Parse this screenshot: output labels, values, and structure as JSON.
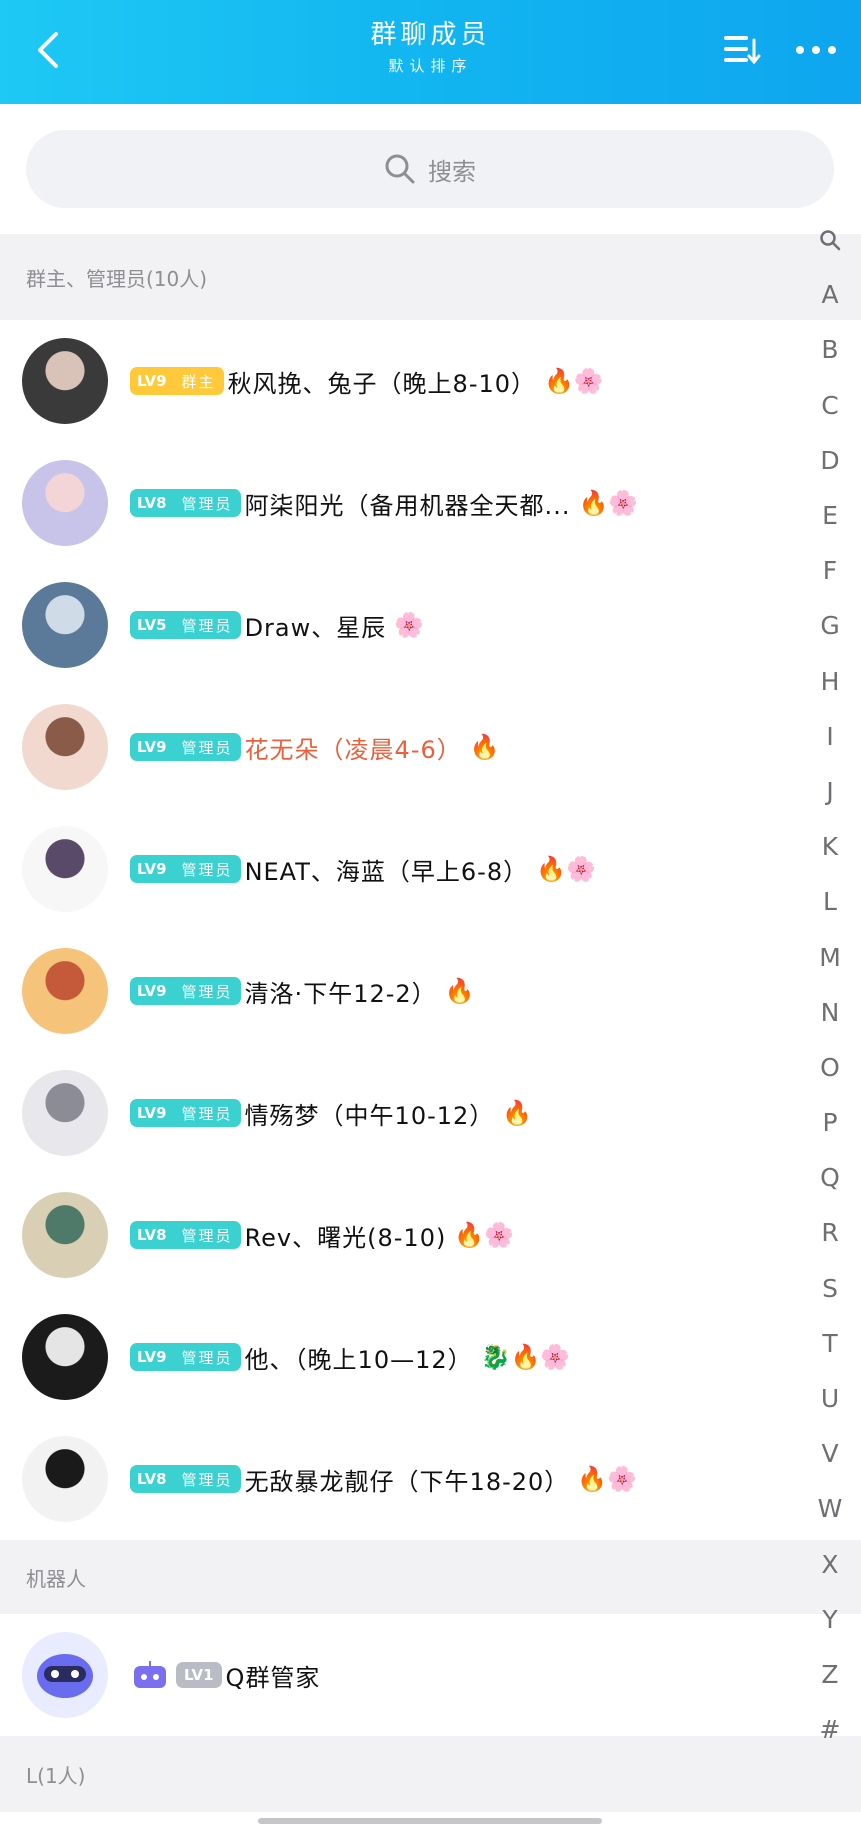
{
  "header": {
    "title": "群聊成员",
    "subtitle": "默认排序"
  },
  "search": {
    "placeholder": "搜索"
  },
  "sections": {
    "owners": "群主、管理员(10人)",
    "robots": "机器人",
    "l_group": "L(1人)"
  },
  "members": [
    {
      "level": "LV9",
      "role": "群主",
      "name": "秋风挽、兔子（晚上8-10）",
      "emoji": "🔥🌸",
      "red": false
    },
    {
      "level": "LV8",
      "role": "管理员",
      "name": "阿柒阳光（备用机器全天都...",
      "emoji": "🔥🌸",
      "red": false
    },
    {
      "level": "LV5",
      "role": "管理员",
      "name": "Draw、星辰",
      "emoji": "🌸",
      "red": false
    },
    {
      "level": "LV9",
      "role": "管理员",
      "name": "花无朵（凌晨4-6）",
      "emoji": "🔥",
      "red": true
    },
    {
      "level": "LV9",
      "role": "管理员",
      "name": "NEAT、海蓝（早上6-8）",
      "emoji": "🔥🌸",
      "red": false
    },
    {
      "level": "LV9",
      "role": "管理员",
      "name": "清洛·下午12-2）",
      "emoji": "🔥",
      "red": false
    },
    {
      "level": "LV9",
      "role": "管理员",
      "name": "情殇梦（中午10-12）",
      "emoji": "🔥",
      "red": false
    },
    {
      "level": "LV8",
      "role": "管理员",
      "name": "Rev、曙光(8-10)",
      "emoji": "🔥🌸",
      "red": false
    },
    {
      "level": "LV9",
      "role": "管理员",
      "name": "他、（晚上10—12）",
      "emoji": "🐉🔥🌸",
      "red": false
    },
    {
      "level": "LV8",
      "role": "管理员",
      "name": "无敌暴龙靓仔（下午18-20）",
      "emoji": "🔥🌸",
      "red": false
    }
  ],
  "robot": {
    "level": "LV1",
    "name": "Q群管家"
  },
  "index_letters": [
    "A",
    "B",
    "C",
    "D",
    "E",
    "F",
    "G",
    "H",
    "I",
    "J",
    "K",
    "L",
    "M",
    "N",
    "O",
    "P",
    "Q",
    "R",
    "S",
    "T",
    "U",
    "V",
    "W",
    "X",
    "Y",
    "Z",
    "#"
  ],
  "colors": {
    "header_gradient_start": "#1ec9f4",
    "header_gradient_end": "#0ea6ef",
    "owner_badge": "#ffc93a",
    "admin_badge": "#3ad1d0",
    "robot_badge": "#b9bcc4",
    "highlight_name": "#e8603c"
  }
}
